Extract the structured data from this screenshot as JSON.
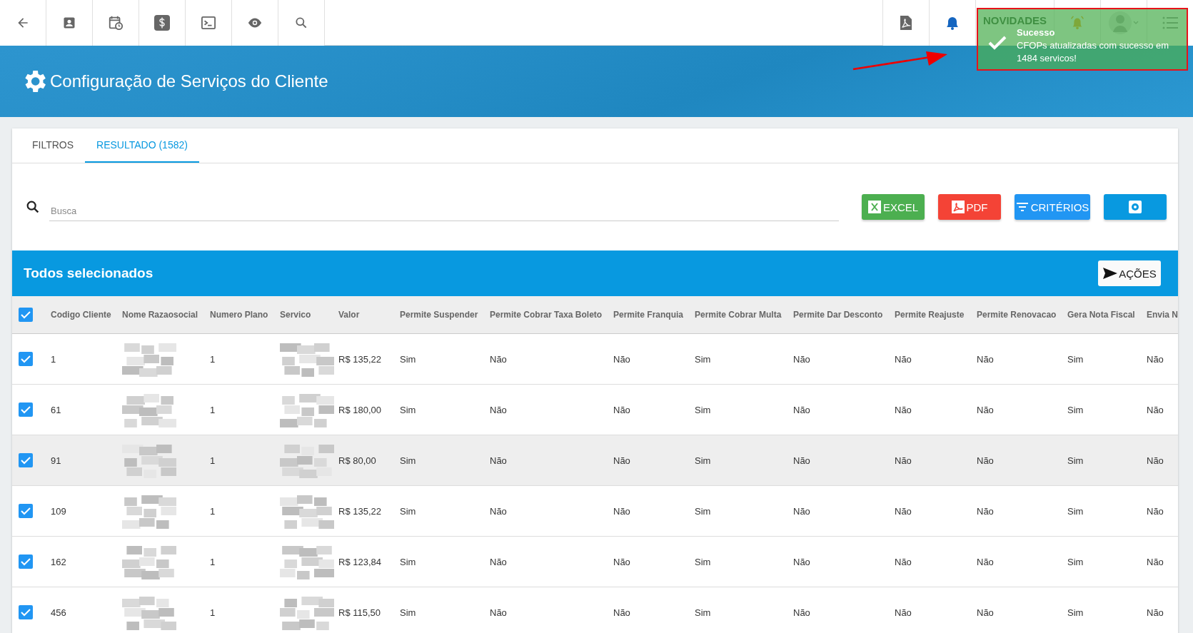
{
  "top_bar": {
    "novidades": "NOVIDADES"
  },
  "page_title": "Configuração de Serviços do Cliente",
  "toast": {
    "title": "Sucesso",
    "message": "CFOPs atualizadas com sucesso em 1484 servicos!"
  },
  "tabs": [
    {
      "label": "FILTROS",
      "selected": false
    },
    {
      "label": "RESULTADO (1582)",
      "selected": true
    }
  ],
  "search": {
    "placeholder": "Busca"
  },
  "buttons": [
    {
      "kind": "excel",
      "label": "EXCEL"
    },
    {
      "kind": "pdf",
      "label": "PDF"
    },
    {
      "kind": "criteria",
      "label": "CRITÉRIOS"
    },
    {
      "kind": "settings"
    }
  ],
  "selection_bar": {
    "title": "Todos selecionados",
    "action": "AÇÕES"
  },
  "table": {
    "all_checked": true,
    "columns": [
      "Codigo Cliente",
      "Nome Razaosocial",
      "Numero Plano",
      "Servico",
      "Valor",
      "Permite Suspender",
      "Permite Cobrar Taxa Boleto",
      "Permite Franquia",
      "Permite Cobrar Multa",
      "Permite Dar Desconto",
      "Permite Reajuste",
      "Permite Renovacao",
      "Gera Nota Fiscal",
      "Envia N"
    ],
    "rows": [
      {
        "checked": true,
        "highlighted": false,
        "cells": [
          "1",
          {
            "kind": "picture"
          },
          "1",
          {
            "kind": "picture"
          },
          "R$ 135,22",
          "Sim",
          "Não",
          "Não",
          "Sim",
          "Não",
          "Não",
          "Não",
          "Sim",
          "Não"
        ]
      },
      {
        "checked": true,
        "highlighted": false,
        "cells": [
          "61",
          {
            "kind": "picture"
          },
          "1",
          {
            "kind": "picture"
          },
          "R$ 180,00",
          "Sim",
          "Não",
          "Não",
          "Sim",
          "Não",
          "Não",
          "Não",
          "Sim",
          "Não"
        ]
      },
      {
        "checked": true,
        "highlighted": true,
        "cells": [
          "91",
          {
            "kind": "picture"
          },
          "1",
          {
            "kind": "picture"
          },
          "R$ 80,00",
          "Sim",
          "Não",
          "Não",
          "Sim",
          "Não",
          "Não",
          "Não",
          "Sim",
          "Não"
        ]
      },
      {
        "checked": true,
        "highlighted": false,
        "cells": [
          "109",
          {
            "kind": "picture"
          },
          "1",
          {
            "kind": "picture"
          },
          "R$ 135,22",
          "Sim",
          "Não",
          "Não",
          "Sim",
          "Não",
          "Não",
          "Não",
          "Sim",
          "Não"
        ]
      },
      {
        "checked": true,
        "highlighted": false,
        "cells": [
          "162",
          {
            "kind": "picture"
          },
          "1",
          {
            "kind": "picture"
          },
          "R$ 123,84",
          "Sim",
          "Não",
          "Não",
          "Sim",
          "Não",
          "Não",
          "Não",
          "Sim",
          "Não"
        ]
      },
      {
        "checked": true,
        "highlighted": false,
        "cells": [
          "456",
          {
            "kind": "picture"
          },
          "1",
          {
            "kind": "picture"
          },
          "R$ 115,50",
          "Sim",
          "Não",
          "Não",
          "Sim",
          "Não",
          "Não",
          "Não",
          "Sim",
          "Não"
        ]
      }
    ]
  }
}
